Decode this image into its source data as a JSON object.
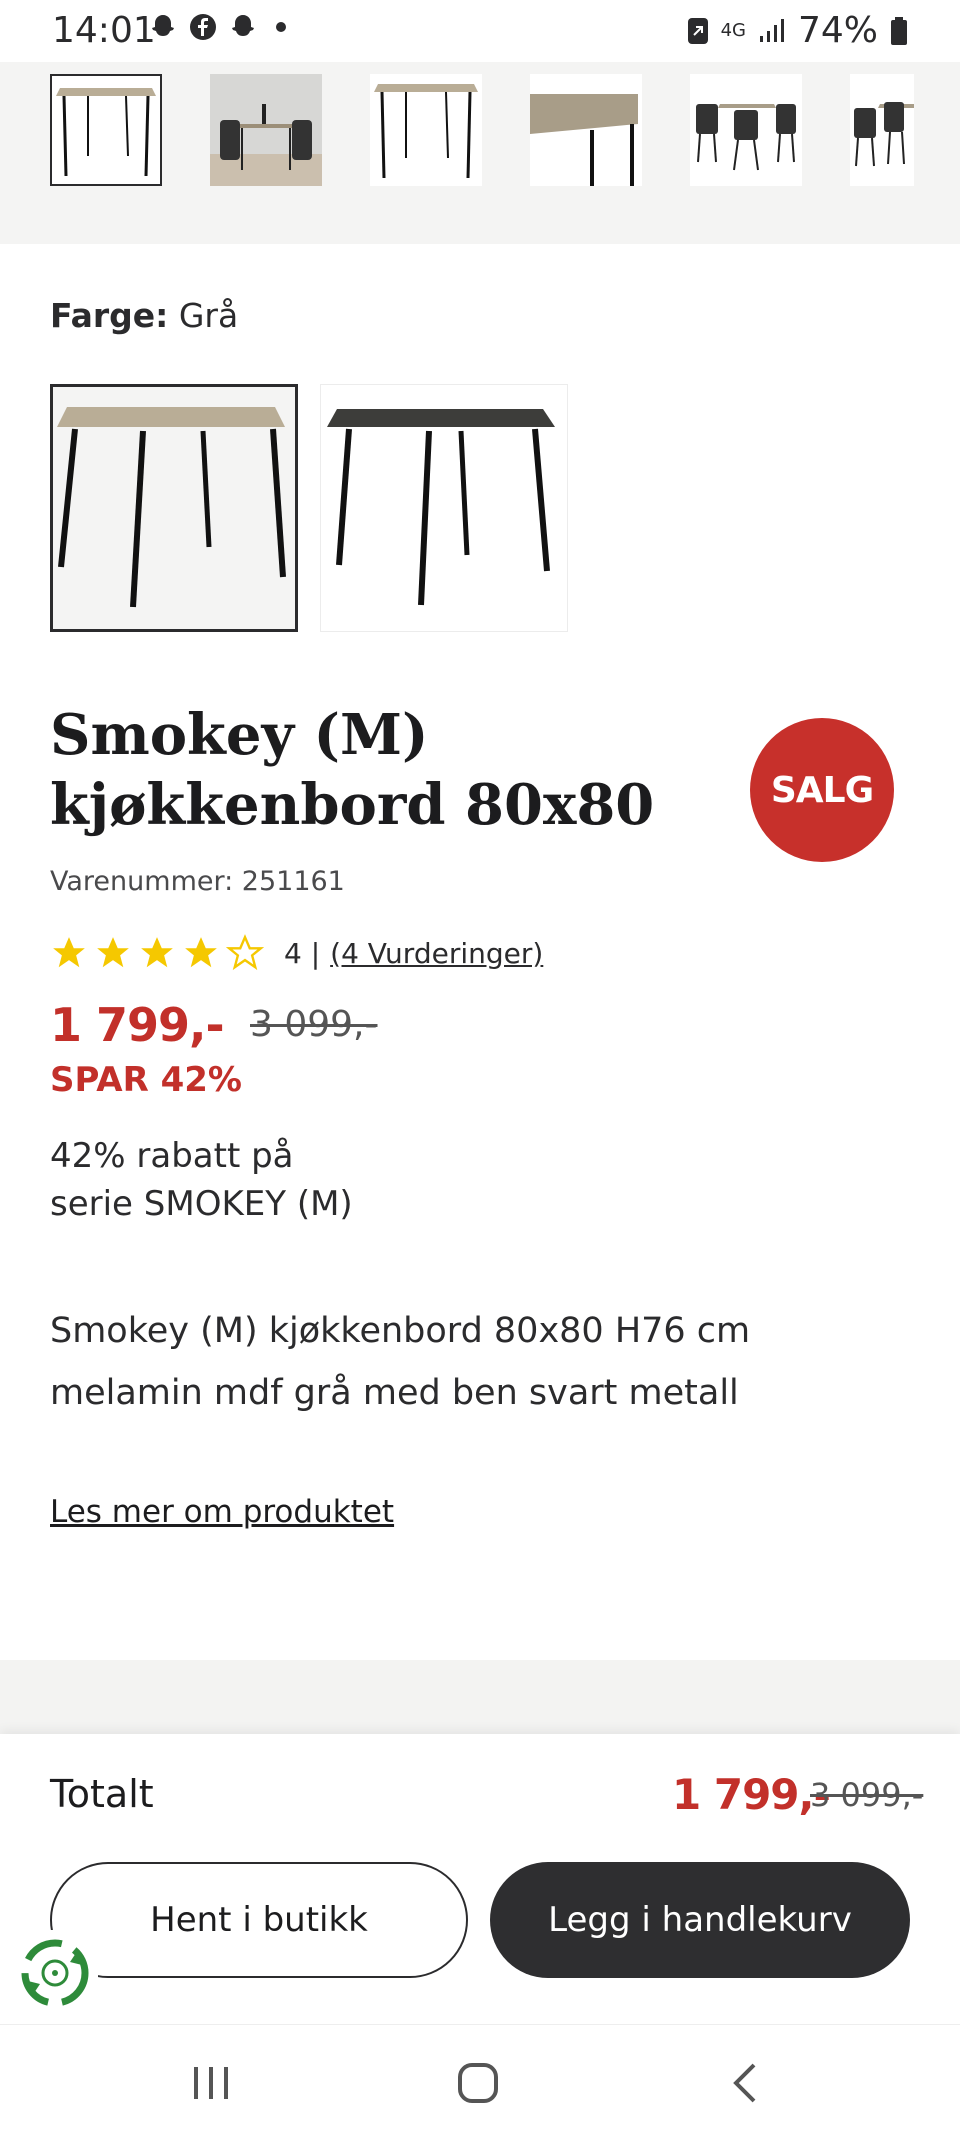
{
  "status_bar": {
    "time": "14:01",
    "network": "4G",
    "battery": "74%"
  },
  "thumbnails": [
    {
      "icon": "table-light-top"
    },
    {
      "icon": "room-scene"
    },
    {
      "icon": "table-light-top"
    },
    {
      "icon": "table-closeup"
    },
    {
      "icon": "dining-set"
    },
    {
      "icon": "dining-set-partial"
    }
  ],
  "color": {
    "label": "Farge:",
    "value": "Grå",
    "options": [
      {
        "icon": "table-grey",
        "selected": true
      },
      {
        "icon": "table-black",
        "selected": false
      }
    ]
  },
  "product": {
    "title_line1": "Smokey (M)",
    "title_line2": "kjøkkenbord 80x80",
    "sku": "Varenummer: 251161",
    "sale_badge": "SALG",
    "rating_value": 4,
    "rating_max": 5,
    "rating_score": "4 |",
    "rating_link": "(4 Vurderinger)",
    "price_now": "1 799,-",
    "price_old": "3 099,-",
    "save_text": "SPAR 42%",
    "discount_line1": "42% rabatt på",
    "discount_line2": "serie SMOKEY (M)",
    "desc_line1": "Smokey (M) kjøkkenbord 80x80 H76 cm",
    "desc_line2": "melamin mdf grå med ben svart metall",
    "read_more": "Les mer om produktet"
  },
  "bottom": {
    "total_label": "Totalt",
    "total_now": "1 799,-",
    "total_old": "3 099,-",
    "store_button": "Hent i butikk",
    "cart_button": "Legg i handlekurv"
  },
  "colors": {
    "sale_red": "#c7302b",
    "dark": "#2e2e30"
  }
}
